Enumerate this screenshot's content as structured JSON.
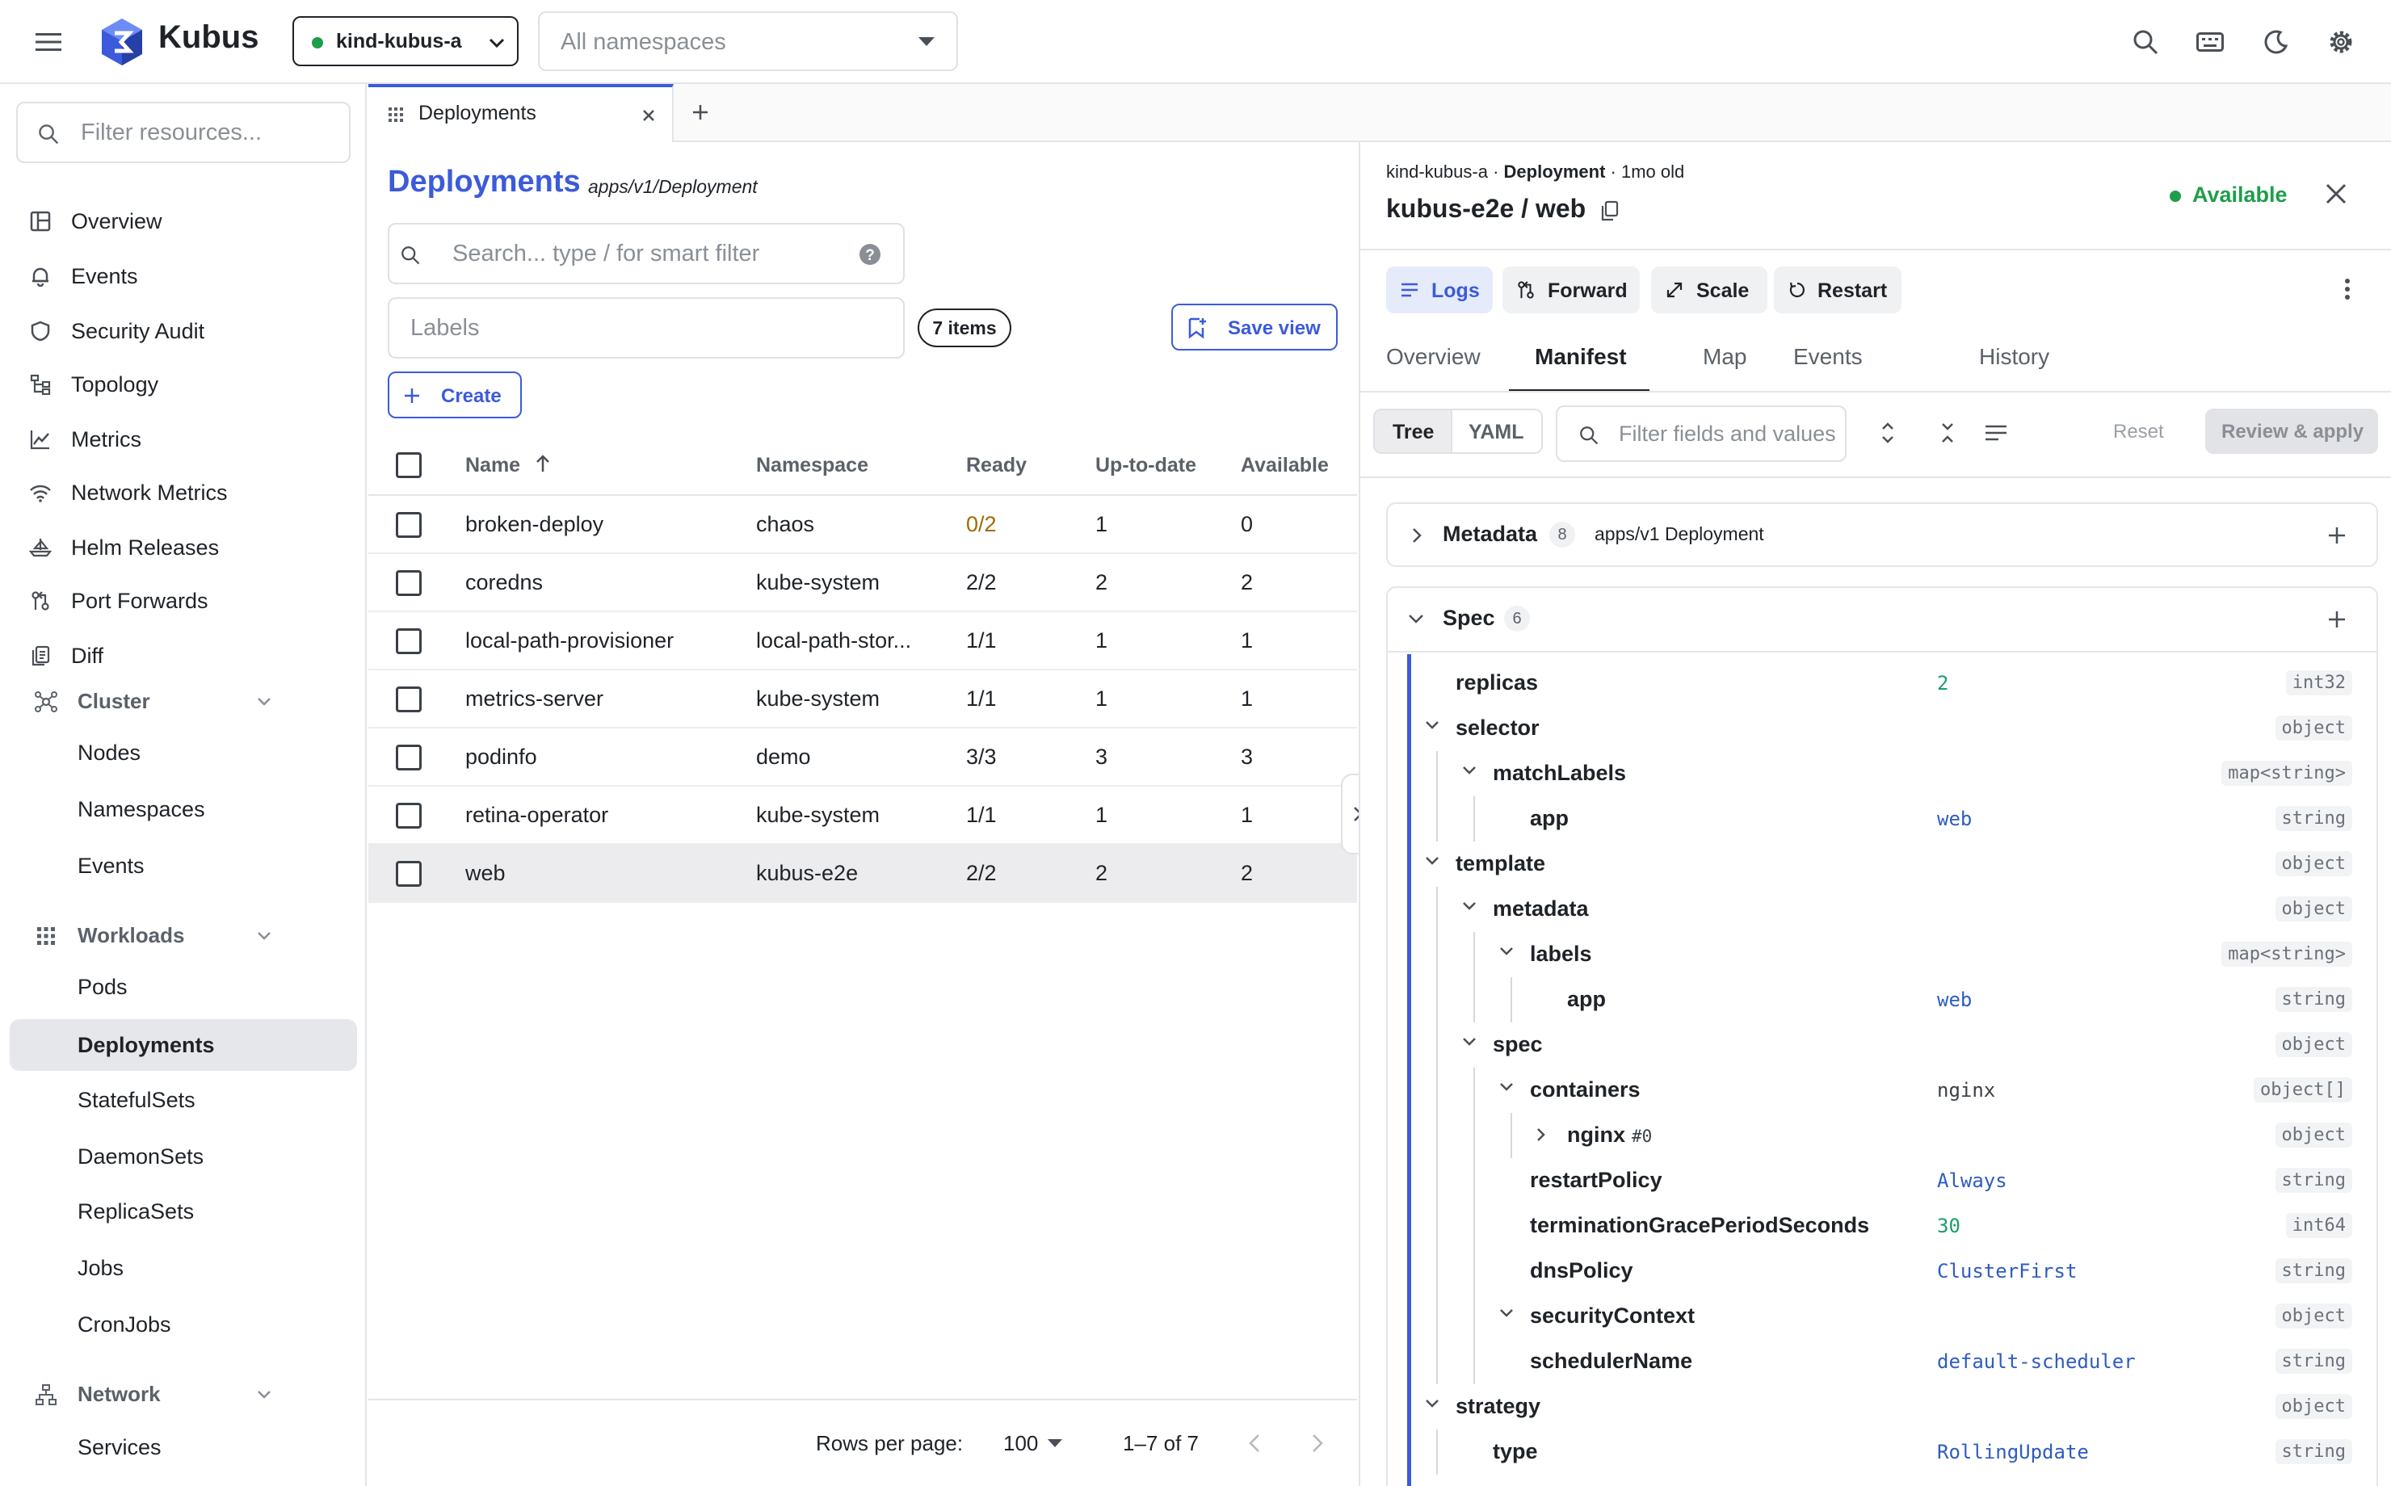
{
  "app": {
    "name": "Kubus",
    "brand_color": "#3b5bdb",
    "accent": "#3b5bdb"
  },
  "topbar": {
    "context": "kind-kubus-a",
    "context_status_color": "#1e9e4a",
    "namespace_placeholder": "All namespaces",
    "icons": [
      "menu-icon",
      "search-icon",
      "keyboard-icon",
      "moon-icon",
      "gear-icon"
    ]
  },
  "sidebar": {
    "filter_placeholder": "Filter resources...",
    "items": [
      {
        "label": "Overview",
        "icon": "layout-icon"
      },
      {
        "label": "Events",
        "icon": "bell-icon"
      },
      {
        "label": "Security Audit",
        "icon": "shield-icon"
      },
      {
        "label": "Topology",
        "icon": "topology-icon"
      },
      {
        "label": "Metrics",
        "icon": "chart-line-icon"
      },
      {
        "label": "Network Metrics",
        "icon": "wifi-icon"
      },
      {
        "label": "Helm Releases",
        "icon": "ship-icon"
      },
      {
        "label": "Port Forwards",
        "icon": "forward-icon"
      },
      {
        "label": "Diff",
        "icon": "diff-icon"
      }
    ],
    "cluster": {
      "label": "Cluster",
      "items": [
        "Nodes",
        "Namespaces",
        "Events"
      ]
    },
    "workloads": {
      "label": "Workloads",
      "items": [
        "Pods",
        "Deployments",
        "StatefulSets",
        "DaemonSets",
        "ReplicaSets",
        "Jobs",
        "CronJobs"
      ],
      "active": "Deployments"
    },
    "network": {
      "label": "Network",
      "items": [
        "Services"
      ]
    }
  },
  "tabs": [
    {
      "label": "Deployments",
      "active": true
    }
  ],
  "list": {
    "title": "Deployments",
    "api": "apps/v1/Deployment",
    "search_placeholder": "Search... type / for smart filter",
    "labels_placeholder": "Labels",
    "count_badge": "7 items",
    "save_view": "Save view",
    "create": "Create",
    "columns": [
      "Name",
      "Namespace",
      "Ready",
      "Up-to-date",
      "Available"
    ],
    "rows": [
      {
        "name": "broken-deploy",
        "namespace": "chaos",
        "ready": "0/2",
        "uptodate": "1",
        "available": "0",
        "warn": true
      },
      {
        "name": "coredns",
        "namespace": "kube-system",
        "ready": "2/2",
        "uptodate": "2",
        "available": "2"
      },
      {
        "name": "local-path-provisioner",
        "namespace": "local-path-stor...",
        "ready": "1/1",
        "uptodate": "1",
        "available": "1"
      },
      {
        "name": "metrics-server",
        "namespace": "kube-system",
        "ready": "1/1",
        "uptodate": "1",
        "available": "1"
      },
      {
        "name": "podinfo",
        "namespace": "demo",
        "ready": "3/3",
        "uptodate": "3",
        "available": "3"
      },
      {
        "name": "retina-operator",
        "namespace": "kube-system",
        "ready": "1/1",
        "uptodate": "1",
        "available": "1"
      },
      {
        "name": "web",
        "namespace": "kubus-e2e",
        "ready": "2/2",
        "uptodate": "2",
        "available": "2",
        "selected": true
      }
    ],
    "footer": {
      "rows_per_page_label": "Rows per page:",
      "rows_per_page": "100",
      "range": "1–7 of 7"
    }
  },
  "detail": {
    "context": "kind-kubus-a",
    "sep1": " · ",
    "kind": "Deployment",
    "age": " · 1mo old",
    "title": "kubus-e2e / web",
    "status": "Available",
    "status_color": "#1e9e4a",
    "actions": [
      "Logs",
      "Forward",
      "Scale",
      "Restart"
    ],
    "tabs": [
      "Overview",
      "Manifest",
      "Map",
      "Events",
      "History"
    ],
    "active_tab": "Manifest",
    "view_modes": [
      "Tree",
      "YAML"
    ],
    "filter_placeholder": "Filter fields and values",
    "reset": "Reset",
    "review_apply": "Review & apply",
    "sections": [
      {
        "label": "Metadata",
        "count": "8",
        "sub": "apps/v1 Deployment",
        "expanded": false
      },
      {
        "label": "Spec",
        "count": "6",
        "expanded": true
      }
    ],
    "tree": [
      {
        "key": "replicas",
        "value": "2",
        "vcolor": "#1a9e6b",
        "type": "int32",
        "depth": 0,
        "chev": ""
      },
      {
        "key": "selector",
        "value": "",
        "type": "object",
        "depth": 0,
        "chev": "down"
      },
      {
        "key": "matchLabels",
        "value": "",
        "type": "map<string>",
        "depth": 1,
        "chev": "down"
      },
      {
        "key": "app",
        "value": "web",
        "vcolor": "#2f5cc0",
        "type": "string",
        "depth": 2,
        "chev": ""
      },
      {
        "key": "template",
        "value": "",
        "type": "object",
        "depth": 0,
        "chev": "down"
      },
      {
        "key": "metadata",
        "value": "",
        "type": "object",
        "depth": 1,
        "chev": "down"
      },
      {
        "key": "labels",
        "value": "",
        "type": "map<string>",
        "depth": 2,
        "chev": "down"
      },
      {
        "key": "app",
        "value": "web",
        "vcolor": "#2f5cc0",
        "type": "string",
        "depth": 3,
        "chev": ""
      },
      {
        "key": "spec",
        "value": "",
        "type": "object",
        "depth": 1,
        "chev": "down"
      },
      {
        "key": "containers",
        "value": "nginx",
        "vcolor": "#3a3f45",
        "type": "object[]",
        "depth": 2,
        "chev": "down"
      },
      {
        "key": "nginx",
        "suffix": "#0",
        "value": "",
        "type": "object",
        "depth": 3,
        "chev": "right"
      },
      {
        "key": "restartPolicy",
        "value": "Always",
        "vcolor": "#2f5cc0",
        "type": "string",
        "depth": 2,
        "chev": ""
      },
      {
        "key": "terminationGracePeriodSeconds",
        "value": "30",
        "vcolor": "#1a9e6b",
        "type": "int64",
        "depth": 2,
        "chev": ""
      },
      {
        "key": "dnsPolicy",
        "value": "ClusterFirst",
        "vcolor": "#2f5cc0",
        "type": "string",
        "depth": 2,
        "chev": ""
      },
      {
        "key": "securityContext",
        "value": "",
        "type": "object",
        "depth": 2,
        "chev": "down"
      },
      {
        "key": "schedulerName",
        "value": "default-scheduler",
        "vcolor": "#2f5cc0",
        "type": "string",
        "depth": 2,
        "chev": ""
      },
      {
        "key": "strategy",
        "value": "",
        "type": "object",
        "depth": 0,
        "chev": "down"
      },
      {
        "key": "type",
        "value": "RollingUpdate",
        "vcolor": "#2f5cc0",
        "type": "string",
        "depth": 1,
        "chev": ""
      }
    ]
  }
}
